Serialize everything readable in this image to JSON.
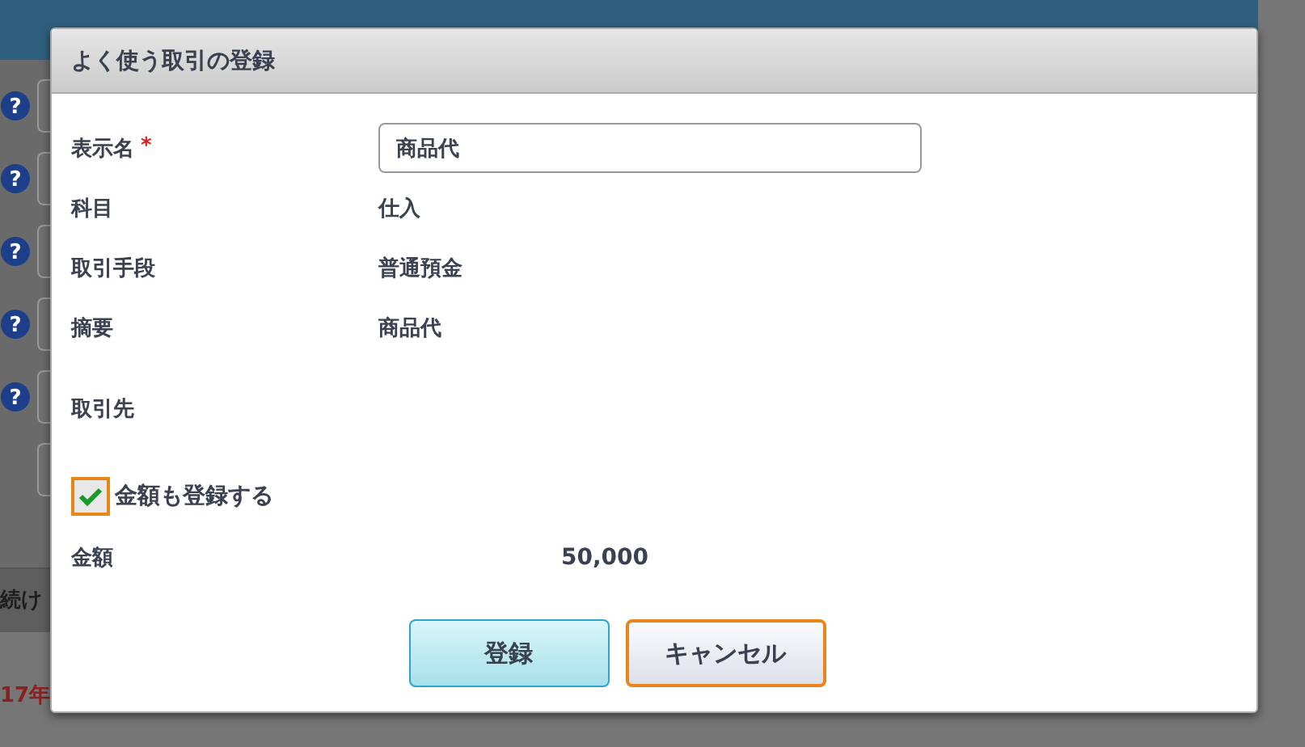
{
  "background": {
    "help_rows": [
      {
        "icon": "?"
      },
      {
        "icon": "?"
      },
      {
        "icon": "?"
      },
      {
        "icon": "?"
      },
      {
        "icon": "?"
      }
    ],
    "fragments": [
      {
        "text": "続け",
        "kind": "plain"
      },
      {
        "text": "17年",
        "kind": "alert"
      }
    ]
  },
  "dialog": {
    "title": "よく使う取引の登録",
    "fields": [
      {
        "label": "表示名",
        "mark": "*",
        "kind": "input",
        "value": "商品代"
      },
      {
        "label": "科目",
        "kind": "text",
        "value": "仕入"
      },
      {
        "label": "取引手段",
        "kind": "text",
        "value": "普通預金"
      },
      {
        "label": "摘要",
        "kind": "text",
        "value": "商品代"
      },
      {
        "label": "取引先",
        "kind": "text"
      }
    ],
    "checkbox": {
      "label": "金額も登録する",
      "checked": true
    },
    "amount": {
      "label": "金額",
      "value": "50,000"
    },
    "buttons": [
      {
        "label": "登録",
        "kind": "primary"
      },
      {
        "label": "キャンセル",
        "kind": "secondary"
      }
    ]
  }
}
